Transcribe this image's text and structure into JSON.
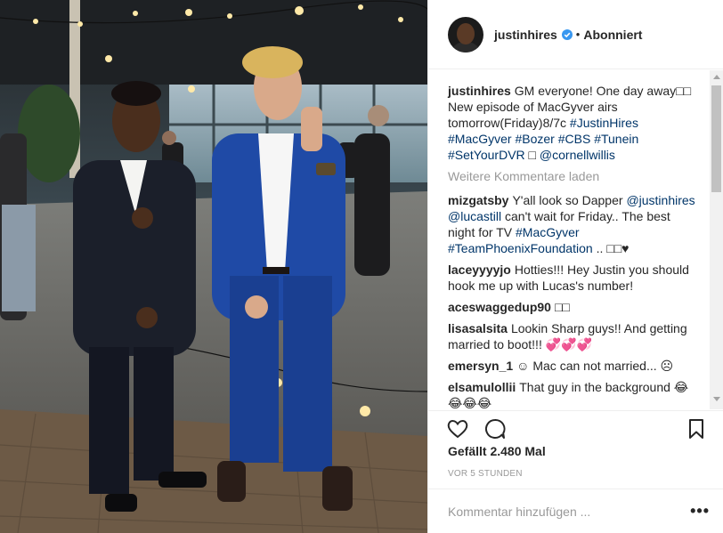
{
  "post": {
    "username": "justinhires",
    "follow_status": "Abonniert",
    "separator": "•"
  },
  "caption": {
    "username": "justinhires",
    "text_a": "GM everyone! One day away",
    "emoji_a": "□□",
    "text_b": "New episode of MacGyver airs tomorrow(Friday)8/7c",
    "tags": [
      "#JustinHires",
      "#MacGyver",
      "#Bozer",
      "#CBS",
      "#Tunein",
      "#SetYourDVR"
    ],
    "emoji_b": "□",
    "mention": "@cornellwillis"
  },
  "load_more": "Weitere Kommentare laden",
  "comments": [
    {
      "username": "mizgatsby",
      "text_a": "Y'all look so Dapper",
      "mention_1": "@justinhires",
      "mention_2": "@lucastill",
      "text_b": "can't wait for Friday.. The best night for TV",
      "tag_1": "#MacGyver",
      "tag_2": "#TeamPhoenixFoundation",
      "text_c": "..",
      "emoji": "□□♥"
    },
    {
      "username": "laceyyyyjo",
      "text": "Hotties!!! Hey Justin you should hook me up with Lucas's number!"
    },
    {
      "username": "aceswaggedup90",
      "text": "□□"
    },
    {
      "username": "lisasalsita",
      "text": "Lookin Sharp guys!! And getting married to boot!!! 💞💞💞"
    },
    {
      "username": "emersyn_1",
      "text": "☺ Mac can not married... ☹"
    },
    {
      "username": "elsamulollii",
      "text": "That guy in the background 😂😂😂😂"
    }
  ],
  "likes": "Gefällt 2.480 Mal",
  "timestamp": "VOR 5 STUNDEN",
  "add_comment_placeholder": "Kommentar hinzufügen ...",
  "more_label": "•••",
  "colors": {
    "link": "#003569",
    "muted": "#999999",
    "text": "#262626",
    "verified": "#3897f0"
  },
  "icons": [
    "heart-icon",
    "comment-icon",
    "bookmark-icon",
    "verified-badge-icon",
    "more-options-icon"
  ]
}
